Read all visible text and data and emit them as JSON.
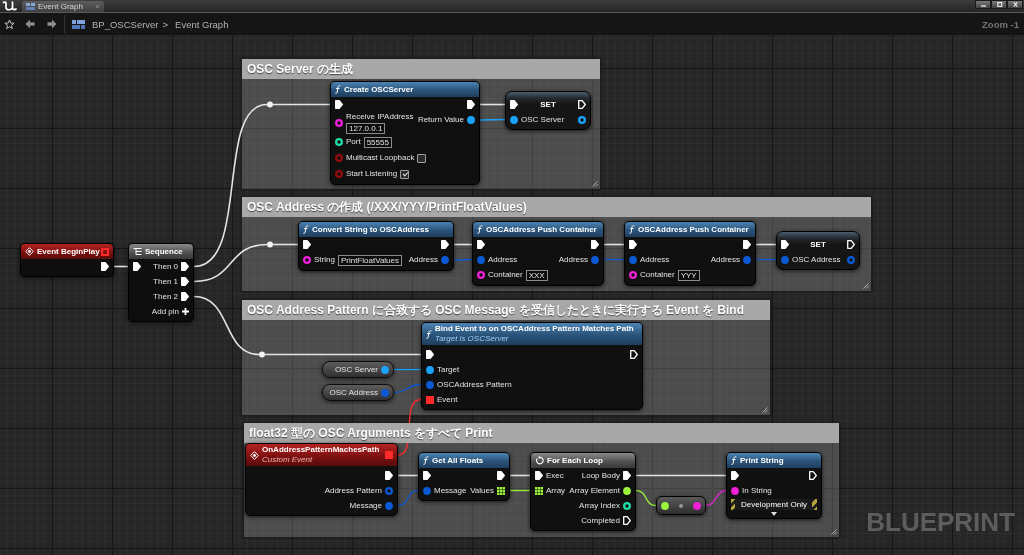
{
  "tab": {
    "label": "Event Graph"
  },
  "breadcrumb": {
    "items": [
      "BP_OSCServer",
      "Event Graph"
    ],
    "separator": ">"
  },
  "zoom_label": "Zoom -1",
  "nodes": [
    {
      "kind": "event",
      "title": "Event BeginPlay",
      "delegate": {
        "kind": "delegate",
        "color": "#ff2b2b",
        "connected": false
      },
      "rows": [
        {
          "right": {
            "kind": "exec",
            "connected": true
          }
        }
      ]
    },
    {
      "kind": "sequence",
      "title": "Sequence",
      "rows": [
        {
          "left": {
            "kind": "exec",
            "connected": true
          },
          "right": {
            "kind": "exec",
            "label": "Then 0",
            "connected": true
          }
        },
        {
          "right": {
            "kind": "exec",
            "label": "Then 1",
            "connected": true
          }
        },
        {
          "right": {
            "kind": "exec",
            "label": "Then 2",
            "connected": true
          }
        },
        {
          "right": {
            "kind": "add",
            "label": "Add pin"
          }
        }
      ]
    }
  ],
  "comments": [
    {
      "title": "OSC Server の生成",
      "nodes": [
        {
          "kind": "function",
          "title": "Create OSCServer",
          "rows": [
            {
              "left": {
                "kind": "exec",
                "connected": true
              },
              "right": {
                "kind": "exec",
                "connected": true
              }
            },
            {
              "left": {
                "kind": "data",
                "label": "Receive IPAddress",
                "color": "#f01fd8",
                "connected": false,
                "value": "127.0.0.1"
              },
              "right": {
                "kind": "data",
                "label": "Return Value",
                "color": "#1aa3ff",
                "connected": true
              }
            },
            {
              "left": {
                "kind": "data",
                "label": "Port",
                "color": "#1fdca8",
                "connected": false,
                "value": "55555"
              }
            },
            {
              "left": {
                "kind": "data",
                "label": "Multicast Loopback",
                "color": "#930b0b",
                "connected": false,
                "checked": false
              }
            },
            {
              "left": {
                "kind": "data",
                "label": "Start Listening",
                "color": "#930b0b",
                "connected": false,
                "checked": true
              }
            }
          ]
        },
        {
          "kind": "set",
          "title": "SET",
          "rows": [
            {
              "left": {
                "kind": "exec",
                "connected": true
              },
              "right": {
                "kind": "exec",
                "connected": false
              }
            },
            {
              "left": {
                "kind": "data",
                "label": "OSC Server",
                "color": "#1aa3ff",
                "connected": true
              },
              "right": {
                "kind": "data",
                "color": "#1aa3ff",
                "connected": false
              }
            }
          ]
        }
      ]
    },
    {
      "title": "OSC Address の作成 (/XXX/YYY/PrintFloatValues)",
      "nodes": [
        {
          "kind": "function",
          "title": "Convert String to OSCAddress",
          "rows": [
            {
              "left": {
                "kind": "exec",
                "connected": true
              },
              "right": {
                "kind": "exec",
                "connected": true
              }
            },
            {
              "left": {
                "kind": "data",
                "label": "String",
                "color": "#f01fd8",
                "connected": false,
                "value": "PrintFloatValues"
              },
              "right": {
                "kind": "data",
                "label": "Address",
                "color": "#0c59d6",
                "connected": true
              }
            }
          ]
        },
        {
          "kind": "function",
          "title": "OSCAddress Push Container",
          "rows": [
            {
              "left": {
                "kind": "exec",
                "connected": true
              },
              "right": {
                "kind": "exec",
                "connected": true
              }
            },
            {
              "left": {
                "kind": "data",
                "label": "Address",
                "color": "#0c59d6",
                "connected": true
              },
              "right": {
                "kind": "data",
                "label": "Address",
                "color": "#0c59d6",
                "connected": true
              }
            },
            {
              "left": {
                "kind": "data",
                "label": "Container",
                "color": "#f01fd8",
                "connected": false,
                "value": "XXX"
              }
            }
          ]
        },
        {
          "kind": "function",
          "title": "OSCAddress Push Container",
          "rows": [
            {
              "left": {
                "kind": "exec",
                "connected": true
              },
              "right": {
                "kind": "exec",
                "connected": true
              }
            },
            {
              "left": {
                "kind": "data",
                "label": "Address",
                "color": "#0c59d6",
                "connected": true
              },
              "right": {
                "kind": "data",
                "label": "Address",
                "color": "#0c59d6",
                "connected": true
              }
            },
            {
              "left": {
                "kind": "data",
                "label": "Container",
                "color": "#f01fd8",
                "connected": false,
                "value": "YYY"
              }
            }
          ]
        },
        {
          "kind": "set",
          "title": "SET",
          "rows": [
            {
              "left": {
                "kind": "exec",
                "connected": true
              },
              "right": {
                "kind": "exec",
                "connected": false
              }
            },
            {
              "left": {
                "kind": "data",
                "label": "OSC Address",
                "color": "#0c59d6",
                "connected": true
              },
              "right": {
                "kind": "data",
                "color": "#0c59d6",
                "connected": false
              }
            }
          ]
        }
      ]
    },
    {
      "title": "OSC Address Pattern に合致する OSC Message を受信したときに実行する Event を Bind",
      "nodes": [
        {
          "kind": "function",
          "title": "Bind Event to on OSCAddress Pattern Matches Path",
          "subtitle": "Target is OSCServer",
          "rows": [
            {
              "left": {
                "kind": "exec",
                "connected": true
              },
              "right": {
                "kind": "exec",
                "connected": false
              }
            },
            {
              "left": {
                "kind": "data",
                "label": "Target",
                "color": "#1aa3ff",
                "connected": true
              }
            },
            {
              "left": {
                "kind": "data",
                "label": "OSCAddress Pattern",
                "color": "#0c59d6",
                "connected": true
              }
            },
            {
              "left": {
                "kind": "delegate",
                "label": "Event",
                "color": "#ff2b2b",
                "connected": true
              }
            }
          ]
        },
        {
          "kind": "getter",
          "rows": [
            {
              "right": {
                "kind": "data",
                "label": "OSC Server",
                "color": "#1aa3ff",
                "connected": true
              }
            }
          ]
        },
        {
          "kind": "getter",
          "rows": [
            {
              "right": {
                "kind": "data",
                "label": "OSC Address",
                "color": "#0c59d6",
                "connected": true
              }
            }
          ]
        }
      ]
    },
    {
      "title": "float32 型の OSC Arguments をすべて Print",
      "nodes": [
        {
          "kind": "event",
          "title": "OnAddressPatternMachesPath",
          "subtitle": "Custom Event",
          "delegate": {
            "kind": "delegate",
            "color": "#ff2b2b",
            "connected": true
          },
          "rows": [
            {
              "right": {
                "kind": "exec",
                "connected": true
              }
            },
            {
              "right": {
                "kind": "data",
                "label": "Address Pattern",
                "color": "#0c59d6",
                "connected": false
              }
            },
            {
              "right": {
                "kind": "data",
                "label": "Message",
                "color": "#0c59d6",
                "connected": true
              }
            }
          ]
        },
        {
          "kind": "function",
          "title": "Get All Floats",
          "rows": [
            {
              "left": {
                "kind": "exec",
                "connected": true
              },
              "right": {
                "kind": "exec",
                "connected": true
              }
            },
            {
              "left": {
                "kind": "data",
                "label": "Message",
                "color": "#0c59d6",
                "connected": true
              },
              "right": {
                "kind": "array",
                "label": "Values",
                "color": "#9af53c",
                "connected": true
              }
            }
          ]
        },
        {
          "kind": "macro",
          "title": "For Each Loop",
          "rows": [
            {
              "left": {
                "kind": "exec",
                "label": "Exec",
                "connected": true
              },
              "right": {
                "kind": "exec",
                "label": "Loop Body",
                "connected": true
              }
            },
            {
              "left": {
                "kind": "array",
                "label": "Array",
                "color": "#9af53c",
                "connected": true
              },
              "right": {
                "kind": "data",
                "label": "Array Element",
                "color": "#9af53c",
                "connected": true
              }
            },
            {
              "right": {
                "kind": "data",
                "label": "Array Index",
                "color": "#1fdca8",
                "connected": false
              }
            },
            {
              "right": {
                "kind": "exec",
                "label": "Completed",
                "connected": false
              }
            }
          ]
        },
        {
          "kind": "convert",
          "rows": [
            {
              "left": {
                "kind": "data",
                "color": "#9af53c",
                "connected": true
              },
              "right": {
                "kind": "data",
                "color": "#f01fd8",
                "connected": true
              }
            }
          ]
        },
        {
          "kind": "function",
          "title": "Print String",
          "banner": "Development Only",
          "expandable": true,
          "rows": [
            {
              "left": {
                "kind": "exec",
                "connected": true
              },
              "right": {
                "kind": "exec",
                "connected": false
              }
            },
            {
              "left": {
                "kind": "data",
                "label": "In String",
                "color": "#f01fd8",
                "connected": true
              }
            }
          ]
        }
      ]
    }
  ],
  "graph_label": "BLUEPRINT"
}
